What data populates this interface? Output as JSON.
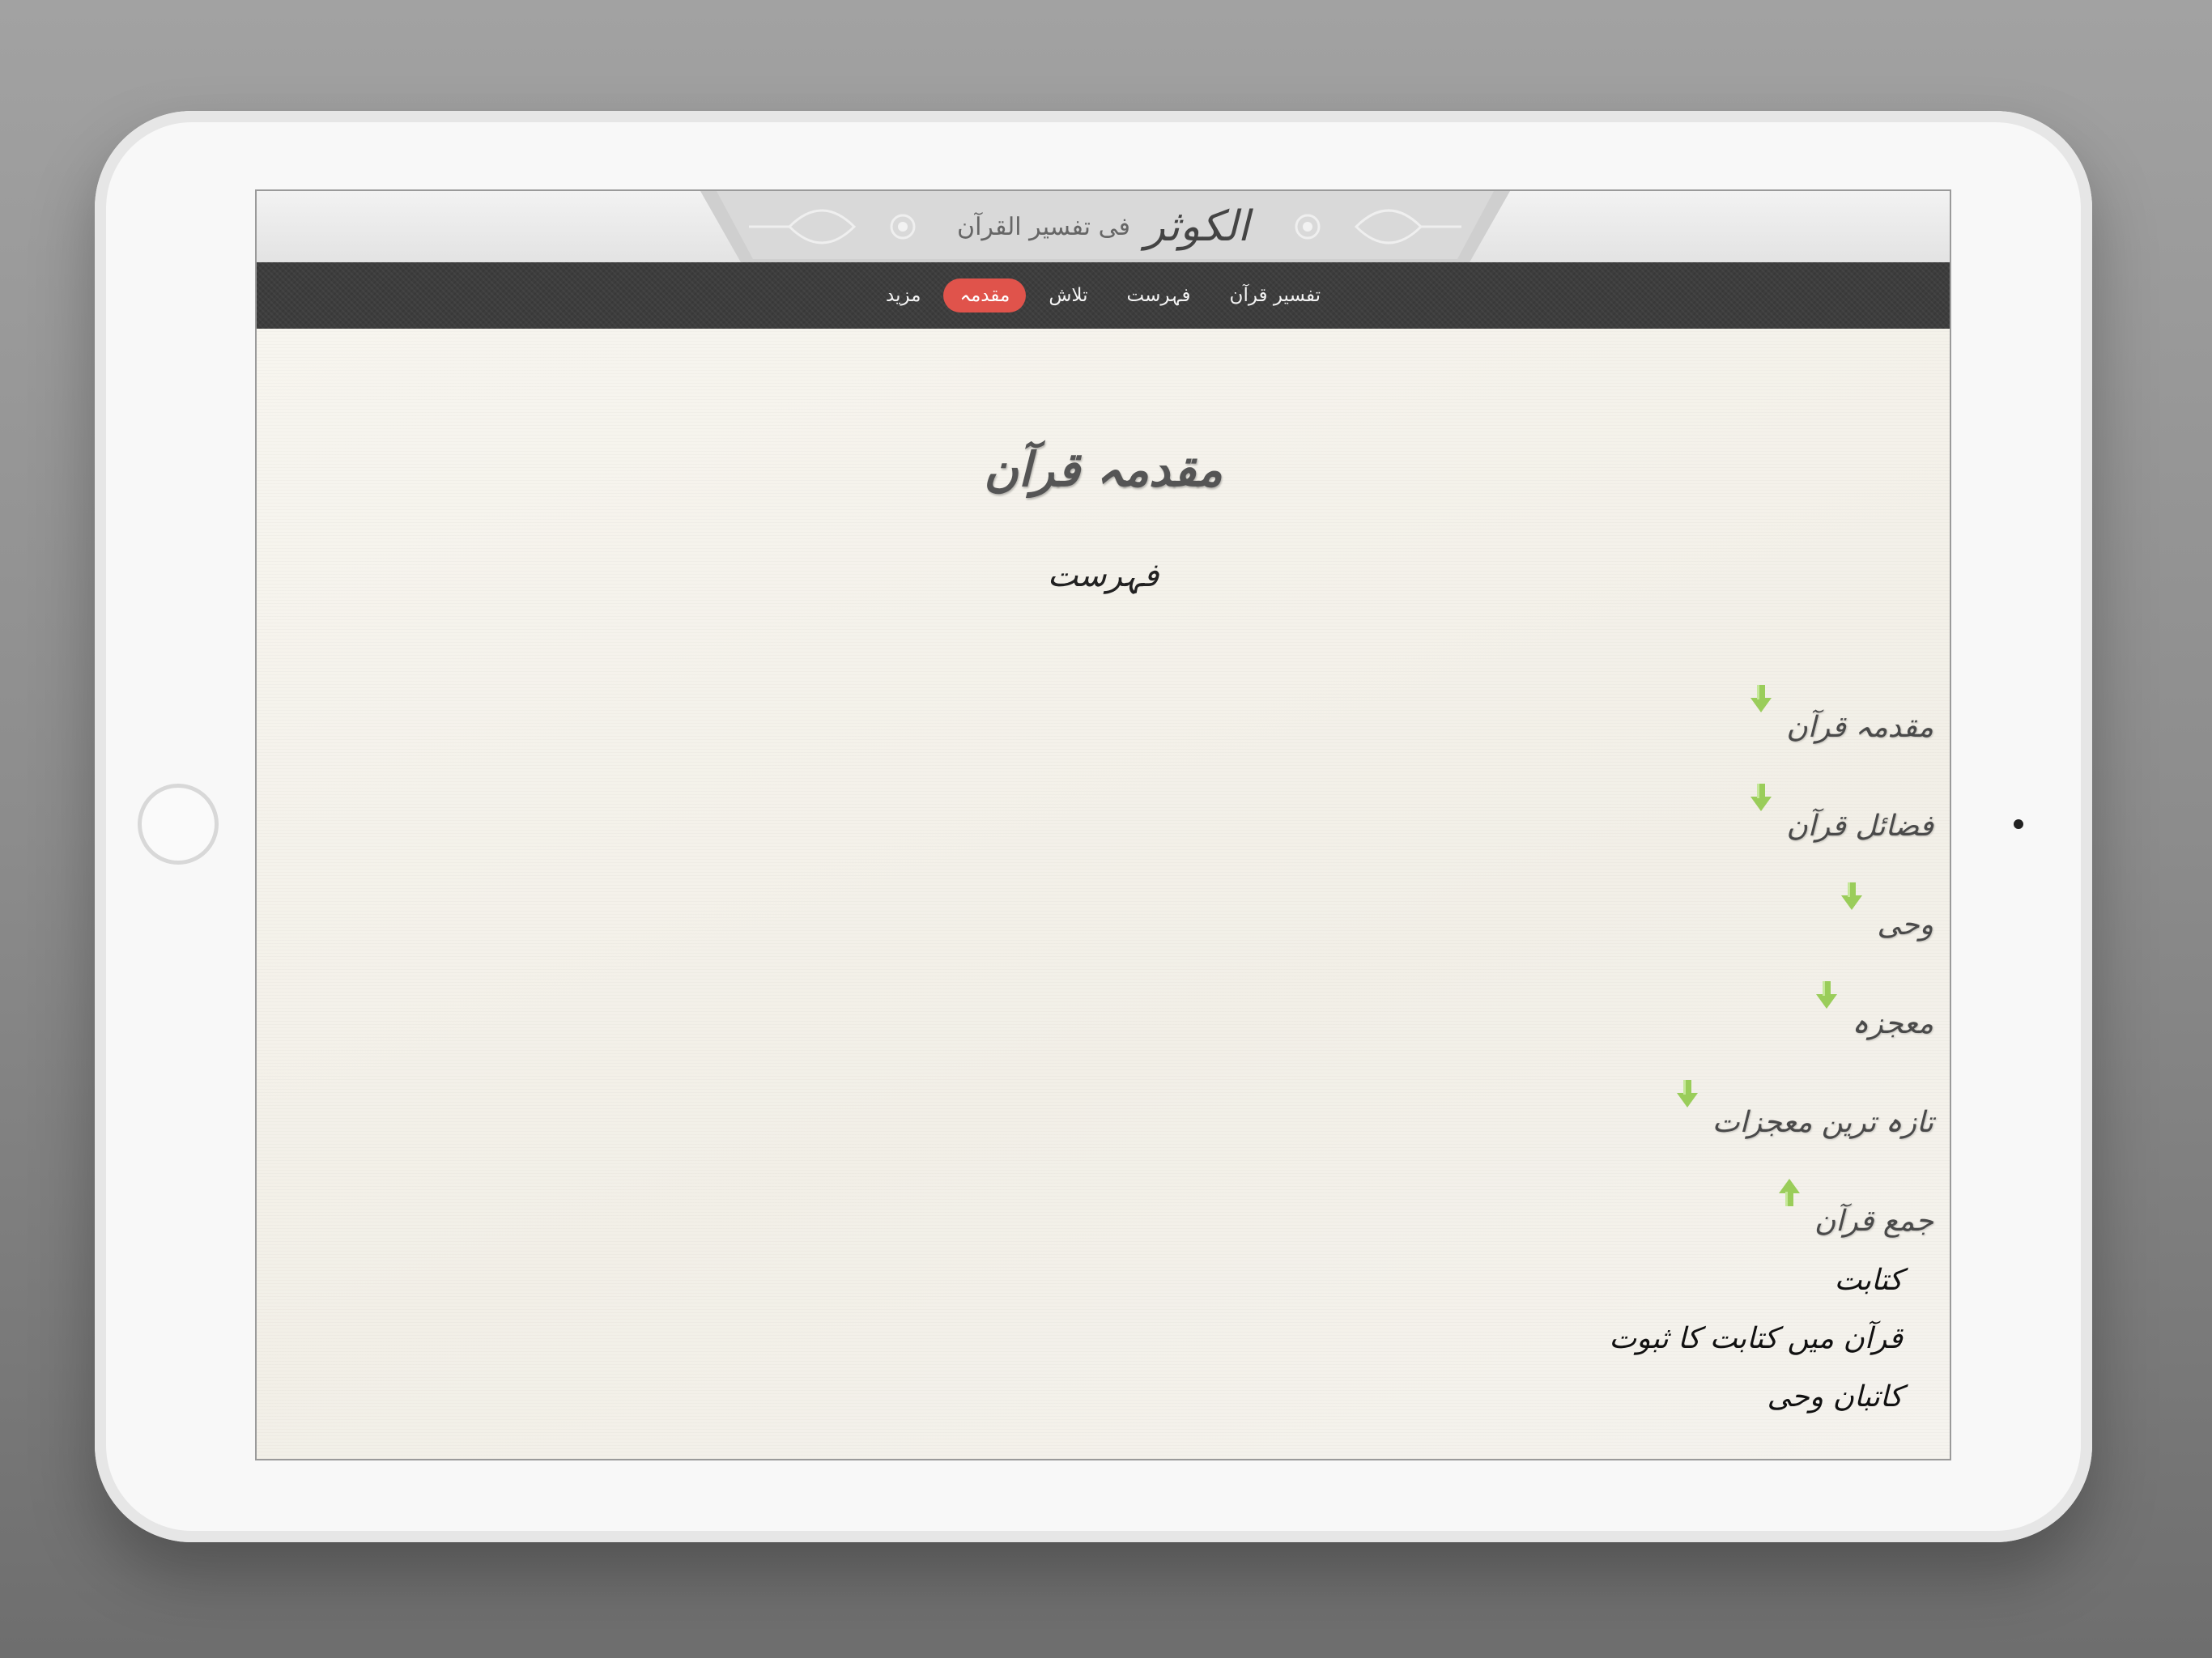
{
  "header": {
    "logo_main": "الکوثر",
    "logo_sub": "فی تفسیر القرآن"
  },
  "nav": {
    "items": [
      {
        "label": "تفسیر قرآن",
        "active": false
      },
      {
        "label": "فہرست",
        "active": false
      },
      {
        "label": "تلاش",
        "active": false
      },
      {
        "label": "مقدمہ",
        "active": true
      },
      {
        "label": "مزید",
        "active": false
      }
    ]
  },
  "main": {
    "title": "مقدمہ قرآن",
    "subtitle": "فہرست",
    "toc": [
      {
        "label": "مقدمہ قرآن",
        "icon": "expand-arrow-down-icon"
      },
      {
        "label": "فضائل قرآن",
        "icon": "expand-arrow-down-icon"
      },
      {
        "label": "وحی",
        "icon": "expand-arrow-down-icon"
      },
      {
        "label": "معجزہ",
        "icon": "expand-arrow-down-icon"
      },
      {
        "label": "تازہ ترین معجزات",
        "icon": "expand-arrow-down-icon"
      },
      {
        "label": "جمع قرآن",
        "icon": "collapse-arrow-up-icon"
      }
    ],
    "subitems": [
      "کتابت",
      "قرآن میں کتابت کا ثبوت",
      "کاتبان وحی"
    ]
  },
  "colors": {
    "nav_active": "#e0534b",
    "nav_bg": "#3d3d3d",
    "arrow": "#9acd5a",
    "page_bg": "#f4f1ea"
  }
}
